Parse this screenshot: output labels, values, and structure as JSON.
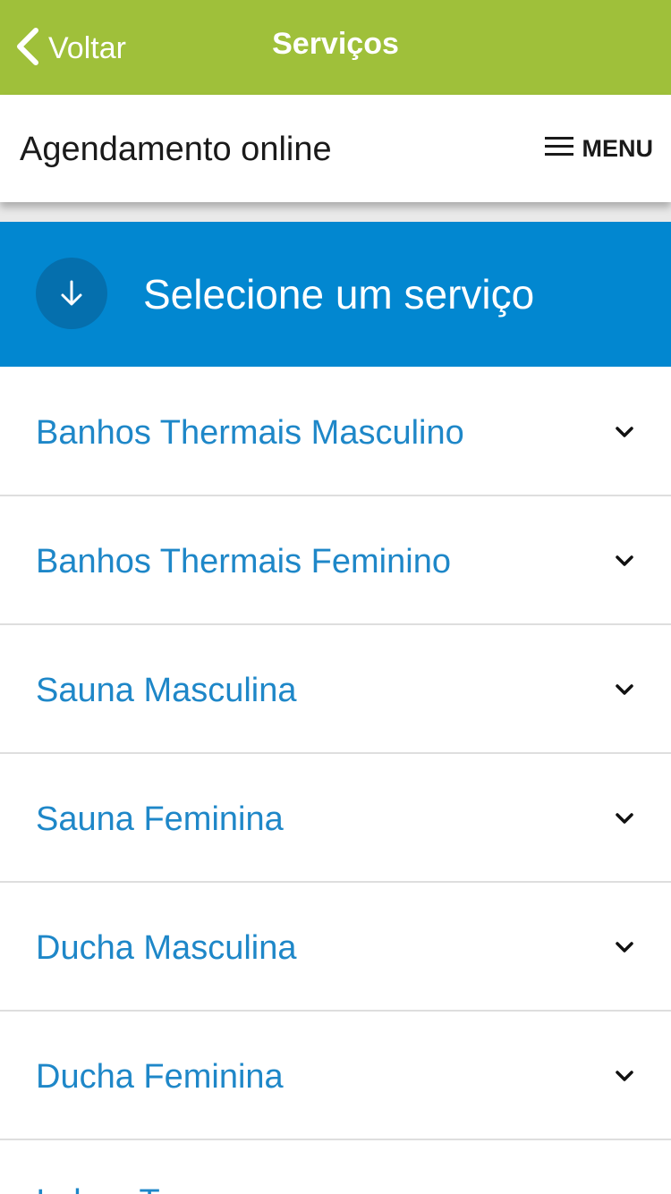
{
  "navbar": {
    "back_label": "Voltar",
    "title": "Serviços",
    "background": "#9fc03a"
  },
  "header": {
    "title": "Agendamento online",
    "menu_label": "MENU"
  },
  "banner": {
    "text": "Selecione um serviço",
    "icon": "arrow-down-icon",
    "background": "#0287d0"
  },
  "services": [
    {
      "label": "Banhos Thermais Masculino"
    },
    {
      "label": "Banhos Thermais Feminino"
    },
    {
      "label": "Sauna Masculina"
    },
    {
      "label": "Sauna Feminina"
    },
    {
      "label": "Ducha Masculina"
    },
    {
      "label": "Ducha Feminina"
    },
    {
      "label": "Imbeo Tera"
    }
  ],
  "colors": {
    "accent_text": "#1e87c8",
    "divider": "#dedede"
  }
}
